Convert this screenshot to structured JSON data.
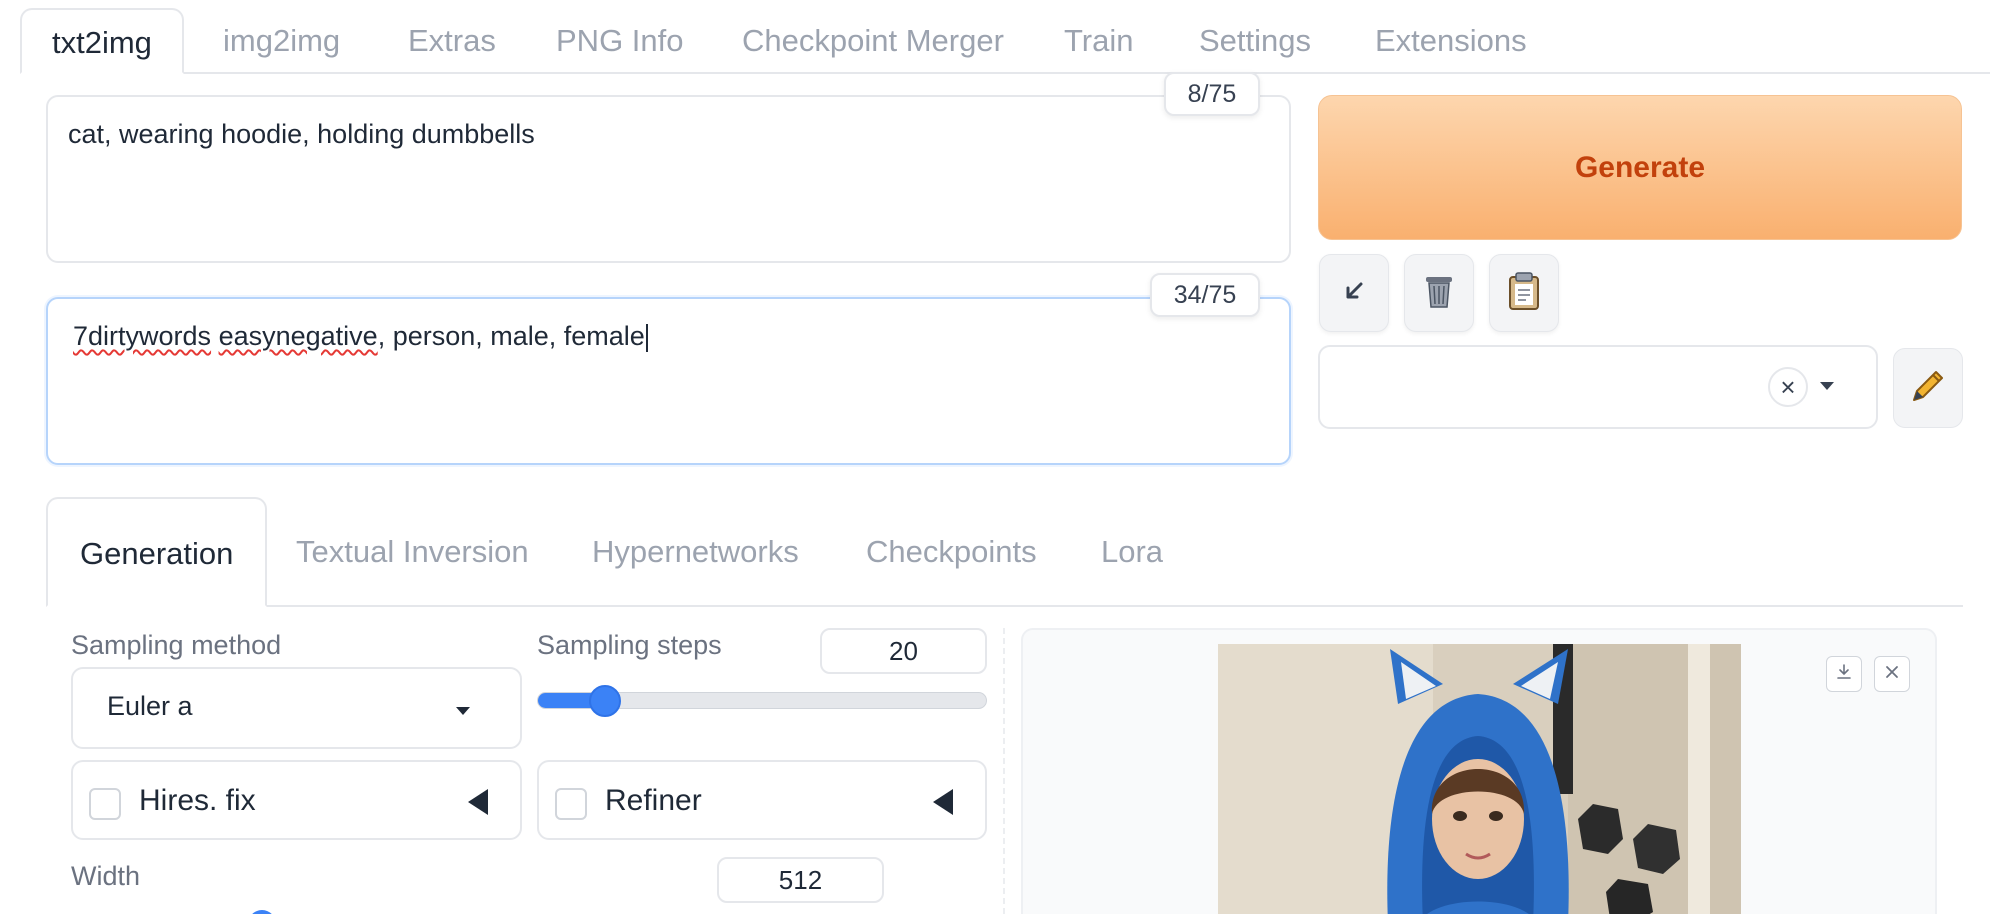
{
  "tabs": [
    "txt2img",
    "img2img",
    "Extras",
    "PNG Info",
    "Checkpoint Merger",
    "Train",
    "Settings",
    "Extensions"
  ],
  "prompt": {
    "value": "cat, wearing hoodie, holding dumbbells",
    "token_count": "8/75"
  },
  "negative_prompt": {
    "misspelled_1": "7dirtywords",
    "space": " ",
    "misspelled_2": "easynegative",
    "rest": ", person, male, female",
    "token_count": "34/75"
  },
  "generate_label": "Generate",
  "tool_icons": [
    "arrow-down-left-icon",
    "trash-icon",
    "clipboard-icon"
  ],
  "styles": {
    "clear_glyph": "×"
  },
  "inner_tabs": [
    "Generation",
    "Textual Inversion",
    "Hypernetworks",
    "Checkpoints",
    "Lora"
  ],
  "generation": {
    "sampling_method_label": "Sampling method",
    "sampling_method_value": "Euler a",
    "sampling_steps_label": "Sampling steps",
    "sampling_steps_value": "20",
    "sampling_steps_fraction": 0.15,
    "hires_fix_label": "Hires. fix",
    "refiner_label": "Refiner",
    "width_label": "Width",
    "width_value": "512"
  },
  "colors": {
    "accent": "#3b82f6",
    "generate_gradient_top": "#fdd6ae",
    "generate_gradient_bottom": "#f9b06f",
    "generate_text": "#c2410c"
  }
}
